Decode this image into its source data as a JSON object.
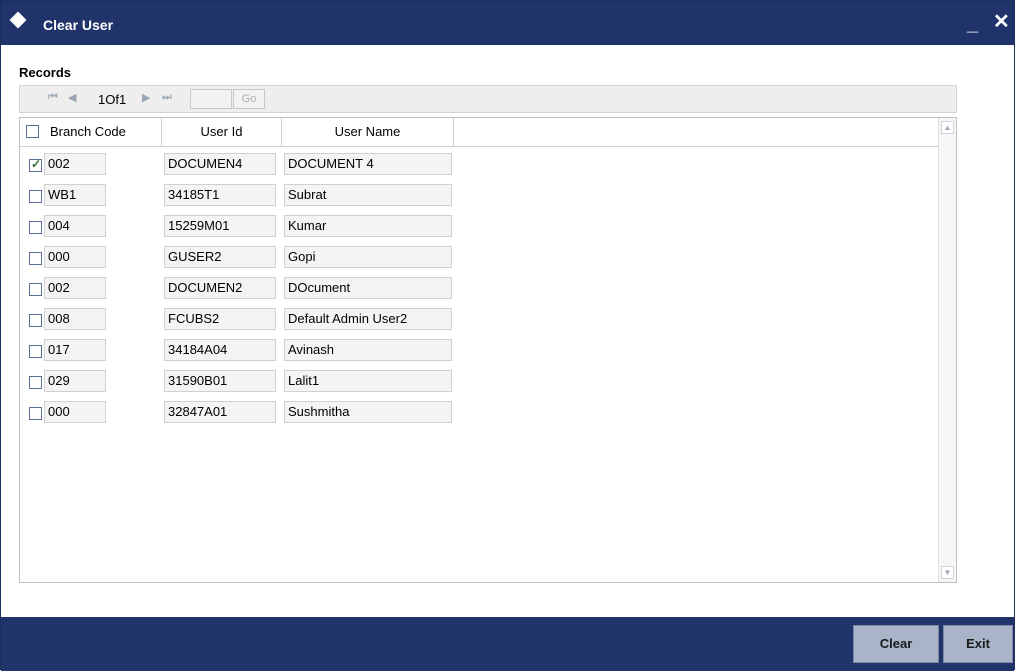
{
  "window": {
    "title": "Clear User",
    "minimize": "_",
    "close": "✕"
  },
  "records_label": "Records",
  "pager": {
    "info": "1Of1",
    "go_label": "Go",
    "first": "⏮",
    "prev": "◀",
    "next": "▶",
    "last": "⏭"
  },
  "grid": {
    "headers": {
      "branch_code": "Branch Code",
      "user_id": "User Id",
      "user_name": "User Name"
    },
    "rows": [
      {
        "checked": true,
        "branch_code": "002",
        "user_id": "DOCUMEN4",
        "user_name": "DOCUMENT 4"
      },
      {
        "checked": false,
        "branch_code": "WB1",
        "user_id": "34185T1",
        "user_name": "Subrat"
      },
      {
        "checked": false,
        "branch_code": "004",
        "user_id": "15259M01",
        "user_name": "Kumar"
      },
      {
        "checked": false,
        "branch_code": "000",
        "user_id": "GUSER2",
        "user_name": "Gopi"
      },
      {
        "checked": false,
        "branch_code": "002",
        "user_id": "DOCUMEN2",
        "user_name": "DOcument"
      },
      {
        "checked": false,
        "branch_code": "008",
        "user_id": "FCUBS2",
        "user_name": "Default Admin User2"
      },
      {
        "checked": false,
        "branch_code": "017",
        "user_id": "34184A04",
        "user_name": "Avinash"
      },
      {
        "checked": false,
        "branch_code": "029",
        "user_id": "31590B01",
        "user_name": "Lalit1"
      },
      {
        "checked": false,
        "branch_code": "000",
        "user_id": "32847A01",
        "user_name": "Sushmitha"
      }
    ]
  },
  "footer": {
    "clear_label": "Clear",
    "exit_label": "Exit"
  },
  "colors": {
    "titlebar": "#20346b",
    "button": "#a9b4c9"
  }
}
